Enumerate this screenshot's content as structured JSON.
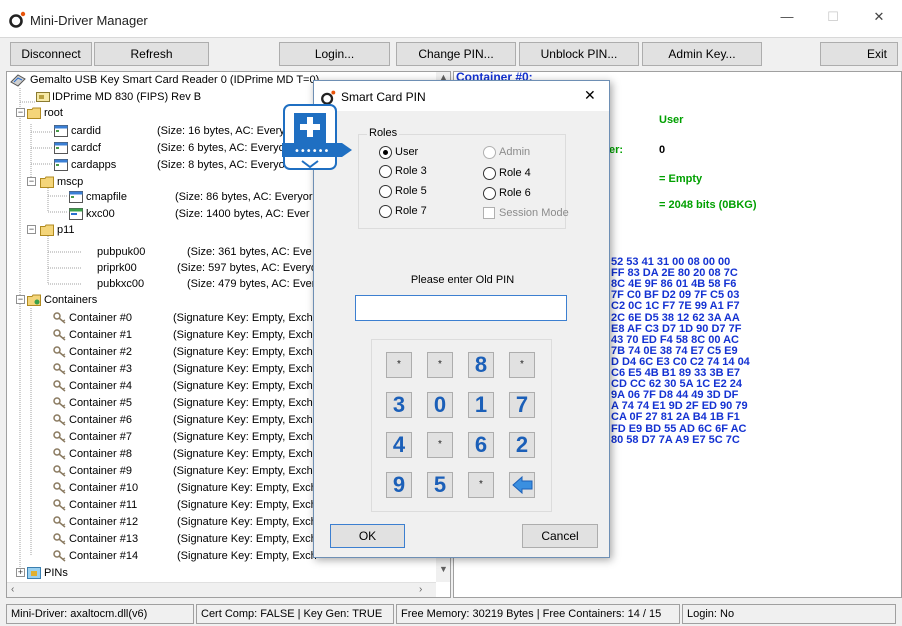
{
  "window": {
    "title": "Mini-Driver Manager",
    "minimize": "—",
    "maximize": "☐",
    "close": "✕"
  },
  "toolbar": {
    "disconnect": "Disconnect",
    "refresh": "Refresh",
    "login": "Login...",
    "change_pin": "Change PIN...",
    "unblock_pin": "Unblock PIN...",
    "admin_key": "Admin Key...",
    "exit": "Exit"
  },
  "tree": {
    "reader": "Gemalto USB Key Smart Card Reader 0 (IDPrime MD T=0)",
    "card": "IDPrime MD 830 (FIPS) Rev B",
    "root": "root",
    "root_files": [
      {
        "name": "cardid",
        "info": "(Size: 16 bytes, AC: Every"
      },
      {
        "name": "cardcf",
        "info": "(Size: 6 bytes, AC: Everyo"
      },
      {
        "name": "cardapps",
        "info": "(Size: 8 bytes, AC: Everyo"
      }
    ],
    "mscp": "mscp",
    "mscp_files": [
      {
        "name": "cmapfile",
        "info": "(Size: 86 bytes, AC: Everyor"
      },
      {
        "name": "kxc00",
        "info": "(Size: 1400 bytes, AC: Ever"
      }
    ],
    "p11": "p11",
    "p11_files": [
      {
        "name": "pubpuk00",
        "info": "(Size: 361 bytes, AC: Eve"
      },
      {
        "name": "priprk00",
        "info": "(Size: 597 bytes, AC: Everyo"
      },
      {
        "name": "pubkxc00",
        "info": "(Size: 479 bytes, AC: Ever"
      }
    ],
    "containers_label": "Containers",
    "containers": [
      {
        "name": "Container #0",
        "info": "(Signature Key: Empty, Excha"
      },
      {
        "name": "Container #1",
        "info": "(Signature Key: Empty, Excha"
      },
      {
        "name": "Container #2",
        "info": "(Signature Key: Empty, Excha"
      },
      {
        "name": "Container #3",
        "info": "(Signature Key: Empty, Excha"
      },
      {
        "name": "Container #4",
        "info": "(Signature Key: Empty, Excha"
      },
      {
        "name": "Container #5",
        "info": "(Signature Key: Empty, Excha"
      },
      {
        "name": "Container #6",
        "info": "(Signature Key: Empty, Excha"
      },
      {
        "name": "Container #7",
        "info": "(Signature Key: Empty, Excha"
      },
      {
        "name": "Container #8",
        "info": "(Signature Key: Empty, Excha"
      },
      {
        "name": "Container #9",
        "info": "(Signature Key: Empty, Excha"
      },
      {
        "name": "Container #10",
        "info": "(Signature Key: Empty, Exch"
      },
      {
        "name": "Container #11",
        "info": "(Signature Key: Empty, Exch"
      },
      {
        "name": "Container #12",
        "info": "(Signature Key: Empty, Exch"
      },
      {
        "name": "Container #13",
        "info": "(Signature Key: Empty, Exch"
      },
      {
        "name": "Container #14",
        "info": "(Signature Key: Empty, Exch"
      }
    ],
    "pins": "PINs"
  },
  "detail": {
    "header": "Container #0:",
    "user_label": "User",
    "er_fragment": "er:",
    "er_value": "0",
    "empty": "= Empty",
    "bits": "= 2048 bits (0BKG)",
    "hex_lines": [
      "52 53 41 31 00 08 00 00",
      "FF 83 DA 2E 80 20 08 7C",
      "8C 4E 9F 86 01 4B 58 F6",
      "7F C0 BF D2 09 7F C5 03",
      "C2 0C 1C F7 7E 99 A1 F7",
      "2C 6E D5 38 12 62 3A AA",
      "E8 AF C3 D7 1D 90 D7 7F",
      "43 70 ED F4 58 8C 00 AC",
      "7B 74 0E 38 74 E7 C5 E9",
      "D D4 6C E3 C0 C2 74 14 04",
      "C6 E5 4B B1 89 33 3B E7",
      "CD CC 62 30 5A 1C E2 24",
      "9A 06 7F D8 44 49 3D DF",
      "A 74 74 E1 9D 2F ED 90 79",
      "CA 0F 27 81 2A B4 1B F1",
      "FD E9 BD 55 AD 6C 6F AC",
      "80 58 D7 7A A9 E7 5C 7C"
    ]
  },
  "status": {
    "driver": "Mini-Driver: axaltocm.dll(v6)",
    "comp": "Cert Comp: FALSE | Key Gen: TRUE",
    "memory": "Free Memory: 30219 Bytes | Free Containers: 14 / 15",
    "login": "Login: No"
  },
  "dialog": {
    "title": "Smart Card PIN",
    "roles_legend": "Roles",
    "roles": [
      {
        "label": "User",
        "selected": true,
        "enabled": true
      },
      {
        "label": "Admin",
        "selected": false,
        "enabled": false
      },
      {
        "label": "Role 3",
        "selected": false,
        "enabled": true
      },
      {
        "label": "Role 4",
        "selected": false,
        "enabled": true
      },
      {
        "label": "Role 5",
        "selected": false,
        "enabled": true
      },
      {
        "label": "Role 6",
        "selected": false,
        "enabled": true
      },
      {
        "label": "Role 7",
        "selected": false,
        "enabled": true
      }
    ],
    "session_mode": "Session Mode",
    "prompt": "Please enter Old PIN",
    "pin_value": "",
    "keypad": [
      [
        "*",
        "*",
        "8",
        "*"
      ],
      [
        "3",
        "0",
        "1",
        "7"
      ],
      [
        "4",
        "*",
        "6",
        "2"
      ],
      [
        "9",
        "5",
        "*",
        "backspace"
      ]
    ],
    "ok": "OK",
    "cancel": "Cancel"
  },
  "colors": {
    "accent_blue": "#1b5fb8",
    "hex_blue": "#1432d2",
    "detail_green": "#00a000"
  }
}
